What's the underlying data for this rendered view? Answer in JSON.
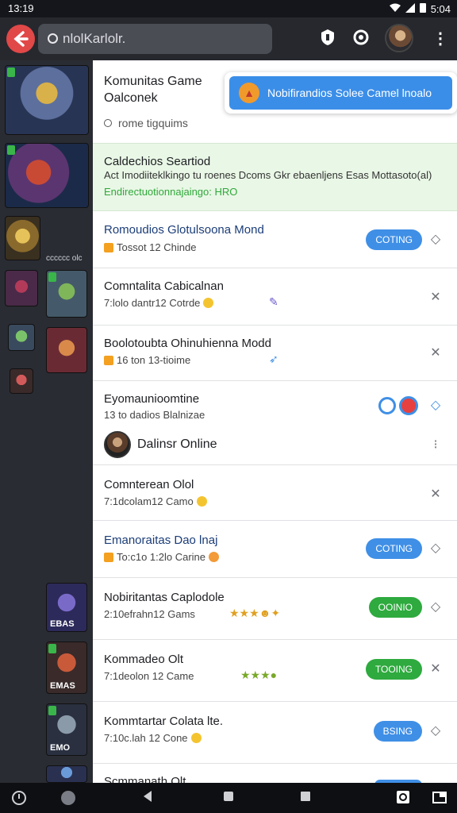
{
  "status_bar": {
    "time": "13:19",
    "right_time": "5:04"
  },
  "app_bar": {
    "back_icon": "arrow-left-icon",
    "search_text": "nlolKarlolr.",
    "icons": [
      "shield-icon",
      "refresh-icon",
      "profile-avatar",
      "more-vertical-icon"
    ]
  },
  "sidebar": {
    "caption_1": "cccccc olc",
    "thumb_tags": [
      "EBAS",
      "EMAS",
      "EMO"
    ]
  },
  "header": {
    "title": "Komunitas Game Oalconek",
    "subtitle": "rome tigquims"
  },
  "notice": {
    "text": "Nobifirandios Solee Camel lnoalo",
    "icon": "warning-icon"
  },
  "activity": {
    "title": "Caldechios Seartiod",
    "desc": "Act Imodiiteklkingo tu roenes Dcoms Gkr ebaenljens Esas Mottasoto(al)",
    "link": "Endirectuotionnajaingo: HRO"
  },
  "rows": [
    {
      "title": "Romoudios Glotulsoona Mond",
      "meta": "Tossot 12 Chinde",
      "pill": "COTING",
      "pill_color": "#3f8fe6",
      "action": "diamond"
    },
    {
      "title": "Comntalita Cabicalnan",
      "meta": "7:lolo dantr12 Cotrde",
      "action": "close"
    },
    {
      "title": "Boolotoubta Ohinuhienna Modd",
      "meta": "16 ton 13-tioime",
      "action": "close"
    },
    {
      "title": "Eyomaunioomtine",
      "meta": "13 to dadios Blalnizae",
      "action": "diamond-blue"
    },
    {
      "title": "Comnterean Olol",
      "meta": "7:1dcolam12 Camo",
      "action": "close"
    },
    {
      "title": "Emanoraitas Dao lnaj",
      "meta": "To:c1o 1:2lo Carine",
      "pill": "COTING",
      "pill_color": "#3f8fe6",
      "action": "diamond"
    },
    {
      "title": "Nobiritantas Caplodole",
      "meta": "2:10efrahn12 Gams",
      "pill": "OOINIO",
      "pill_color": "#2eaa3e",
      "action": "diamond"
    },
    {
      "title": "Kommadeo Olt",
      "meta": "7:1deolon 12 Came",
      "pill": "TOOING",
      "pill_color": "#2eaa3e",
      "action": "close-grey"
    },
    {
      "title": "Kommtartar Colata lte.",
      "meta": "7:10c.lah 12 Cone",
      "pill": "BSING",
      "pill_color": "#3f8fe6",
      "action": "diamond"
    },
    {
      "title": "Scmmanath Olt"
    }
  ],
  "online": {
    "label": "Dalinsr Online"
  },
  "navbar": {
    "icons": [
      "assistant-icon",
      "app-thumbnail-icon",
      "back-triangle-icon",
      "home-square-icon",
      "recents-square-icon",
      "screenshot-icon",
      "split-screen-icon"
    ]
  },
  "colors": {
    "accent_blue": "#3f8fe6",
    "accent_green": "#2eaa3e",
    "back_red": "#e14848",
    "warning": "#f19a2c"
  }
}
